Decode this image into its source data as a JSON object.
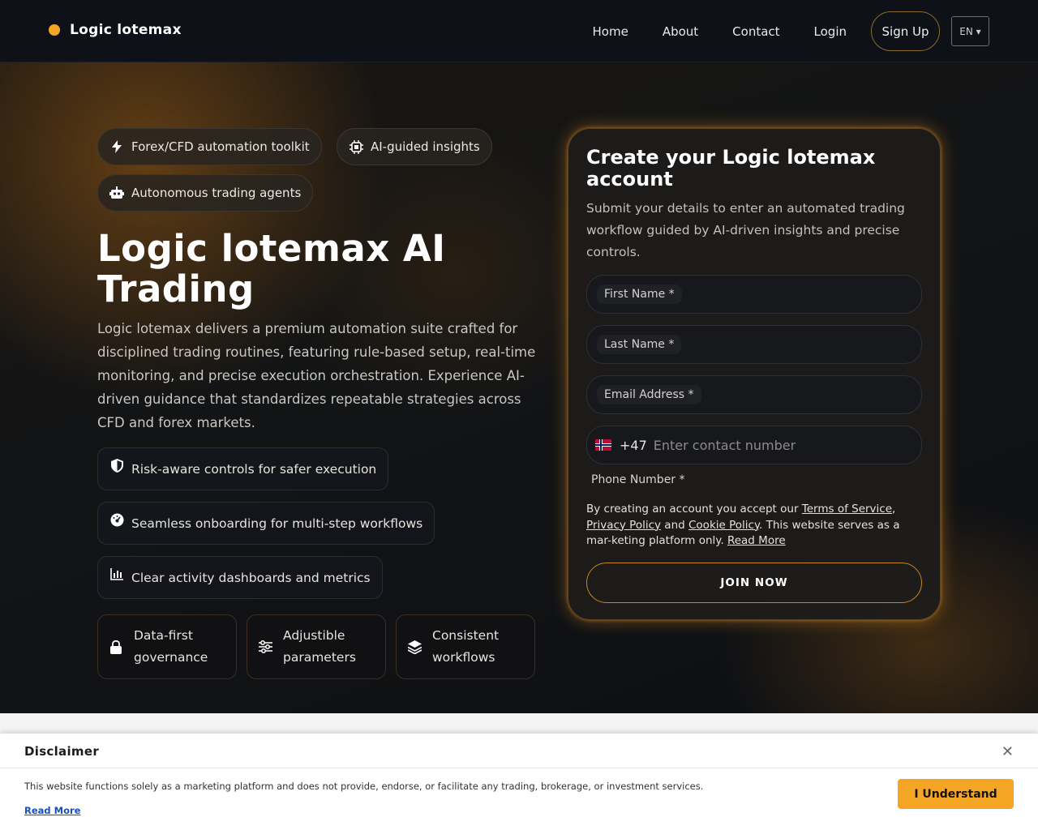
{
  "brand": {
    "name": "Logic lotemax",
    "accent_color": "#f5a524"
  },
  "nav": {
    "links": [
      "Home",
      "About",
      "Contact",
      "Login"
    ],
    "signup": "Sign Up",
    "language": "EN ▾"
  },
  "hero": {
    "chips": [
      {
        "icon": "bolt-icon",
        "label": "Forex/CFD automation toolkit"
      },
      {
        "icon": "chip-icon",
        "label": "AI-guided insights"
      },
      {
        "icon": "robot-icon",
        "label": "Autonomous trading agents"
      }
    ],
    "title": "Logic lotemax AI Trading",
    "description": "Logic lotemax delivers a premium automation suite crafted for disciplined trading routines, featuring rule-based setup, real-time monitoring, and precise execution orchestration. Experience AI-driven guidance that standardizes repeatable strategies across CFD and forex markets.",
    "features": [
      {
        "icon": "shield-icon",
        "label": "Risk-aware controls for safer execution"
      },
      {
        "icon": "gauge-icon",
        "label": "Seamless onboarding for multi-step workflows"
      },
      {
        "icon": "bar-chart-icon",
        "label": "Clear activity dashboards and metrics"
      }
    ],
    "cards": [
      {
        "icon": "lock-icon",
        "line1": "Data-first",
        "line2": "governance"
      },
      {
        "icon": "sliders-icon",
        "line1": "Adjustible",
        "line2": "parameters"
      },
      {
        "icon": "layers-icon",
        "line1": "Consistent",
        "line2": "workflows"
      }
    ]
  },
  "form": {
    "title": "Create your Logic lotemax account",
    "subtitle": "Submit your details to enter an automated trading workflow guided by AI-driven insights and precise controls.",
    "first_name_label": "First Name *",
    "last_name_label": "Last Name *",
    "email_label": "Email Address *",
    "phone_dial_code": "+47",
    "phone_placeholder": "Enter contact number",
    "phone_label": "Phone Number *",
    "terms_prefix": "By creating an account you accept our ",
    "terms_link": "Terms of Service",
    "terms_comma": ",",
    "privacy_link": "Privacy Policy",
    "and": " and ",
    "cookie_link": "Cookie Policy",
    "terms_suffix": ". This website serves as a mar-keting platform only. ",
    "read_more": "Read More",
    "submit": "JOIN NOW"
  },
  "disclaimer": {
    "title": "Disclaimer",
    "text": "This website functions solely as a marketing platform and does not provide, endorse, or facilitate any trading, brokerage, or investment services.",
    "read_more": "Read More",
    "button": "I Understand",
    "close": "✕"
  }
}
